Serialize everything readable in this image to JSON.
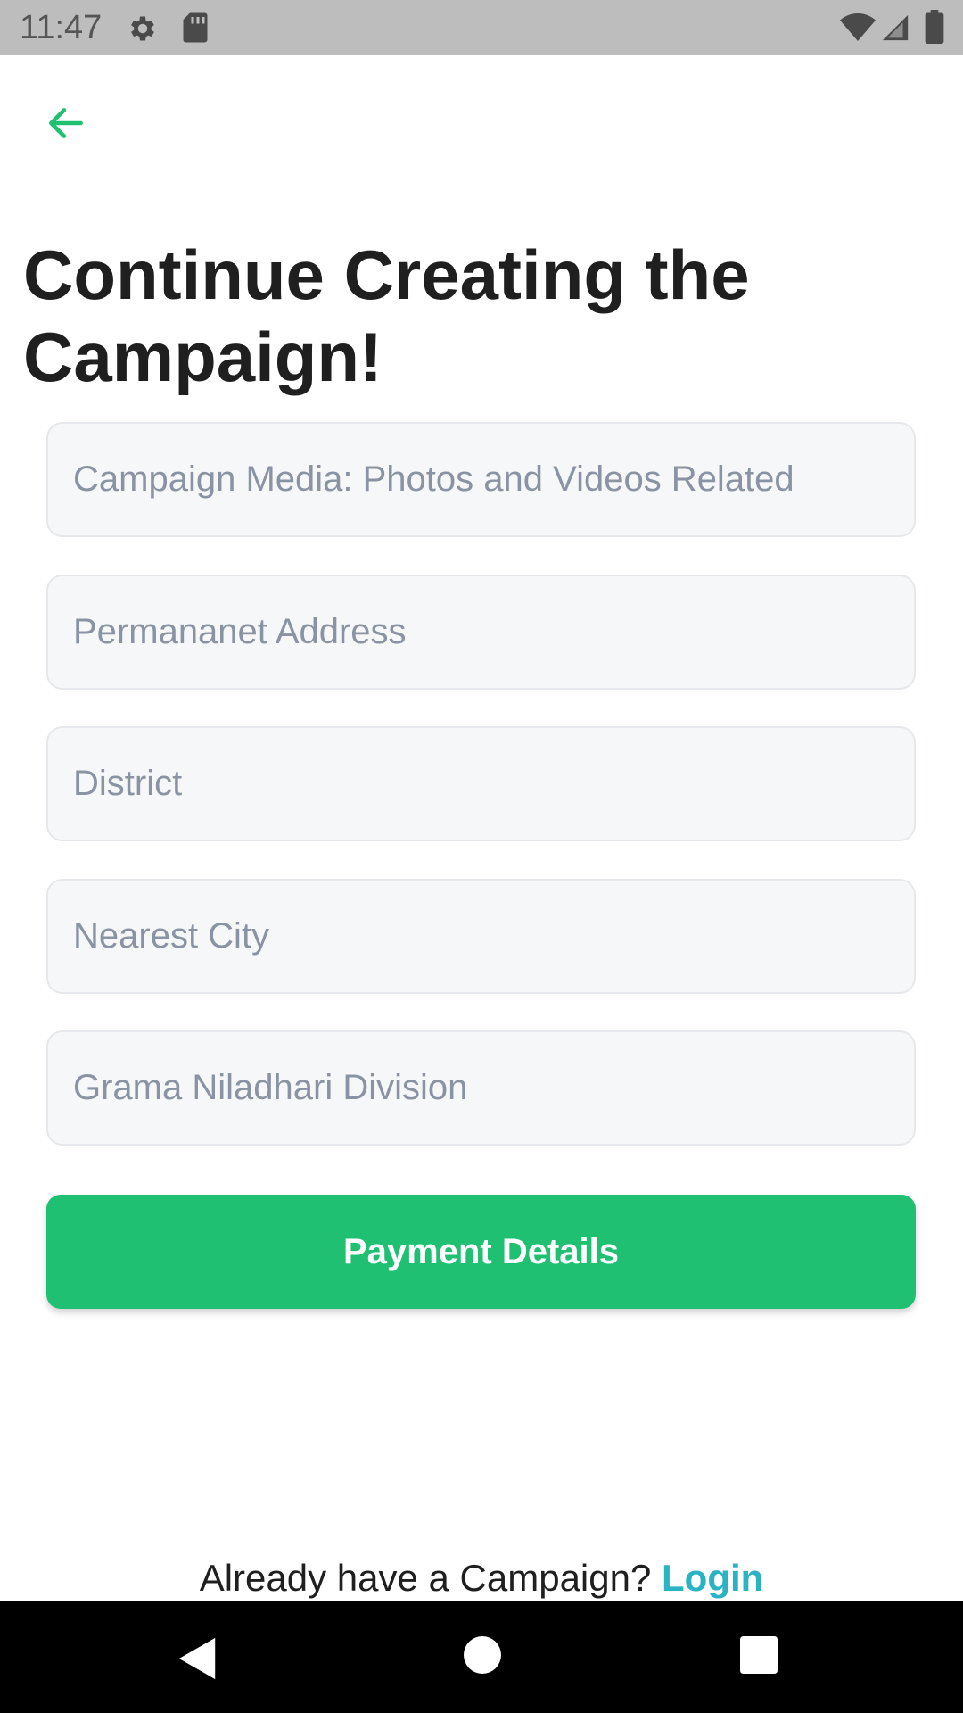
{
  "status_bar": {
    "time": "11:47",
    "icons": [
      "gear-icon",
      "sd-card-icon",
      "wifi-icon",
      "signal-icon",
      "battery-icon"
    ]
  },
  "header": {
    "back_icon": "arrow-left-icon"
  },
  "title": "Continue Creating the Campaign!",
  "form": {
    "fields": [
      {
        "placeholder": "Campaign Media: Photos and Videos Related",
        "value": ""
      },
      {
        "placeholder": "Permananet Address",
        "value": ""
      },
      {
        "placeholder": "District",
        "value": ""
      },
      {
        "placeholder": "Nearest City",
        "value": ""
      },
      {
        "placeholder": "Grama Niladhari Division",
        "value": ""
      }
    ],
    "submit_label": "Payment Details"
  },
  "footer": {
    "prompt": "Already have a Campaign? ",
    "link_label": "Login"
  },
  "nav_bar": {
    "icons": [
      "nav-back-icon",
      "nav-home-icon",
      "nav-recents-icon"
    ]
  },
  "colors": {
    "accent": "#20c073",
    "link": "#2ab3c3",
    "status_bar": "#bdbdbd",
    "field_bg": "#f6f7f9",
    "placeholder": "#8a93a3"
  }
}
